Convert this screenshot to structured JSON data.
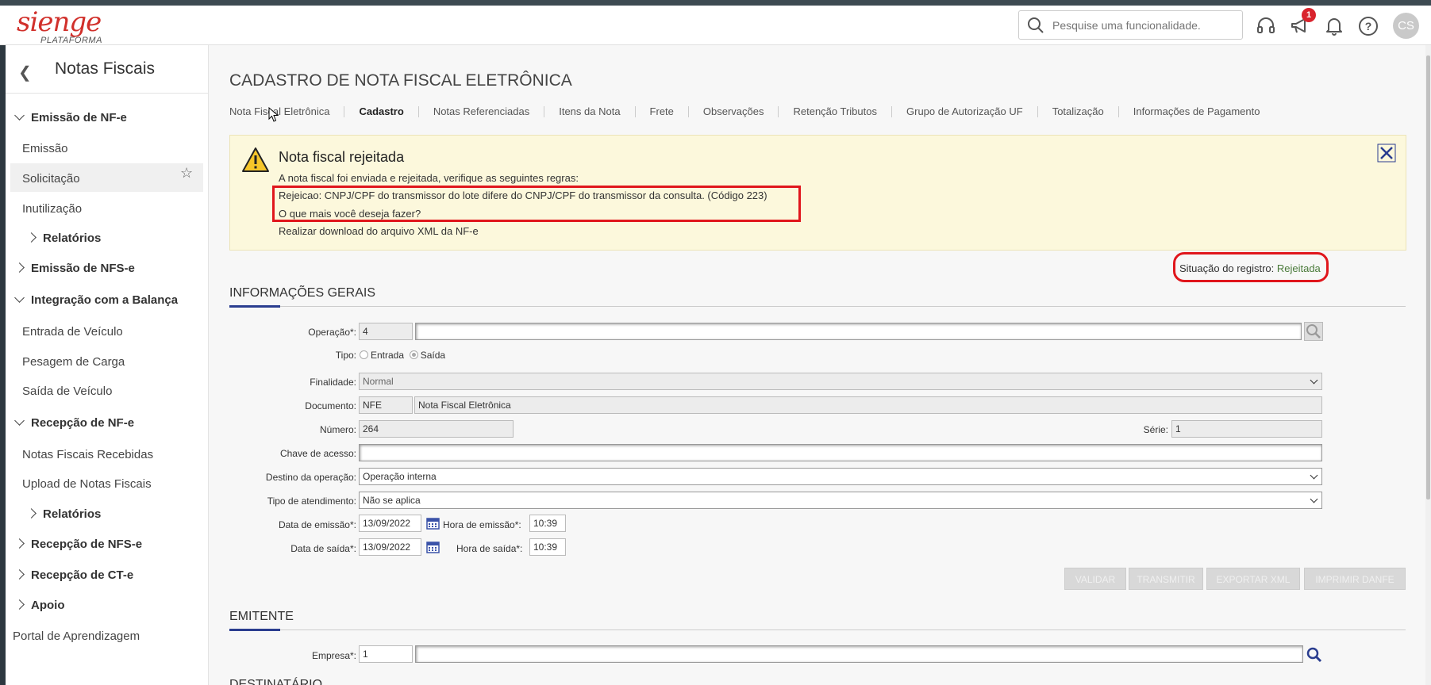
{
  "header": {
    "logo_main": "sienge",
    "logo_sub": "PLATAFORMA",
    "search_placeholder": "Pesquise uma funcionalidade.",
    "notification_count": "1",
    "avatar_initials": "CS"
  },
  "sidebar": {
    "title": "Notas Fiscais",
    "items": [
      {
        "label": "Emissão de NF-e",
        "type": "group-open"
      },
      {
        "label": "Emissão",
        "type": "item"
      },
      {
        "label": "Solicitação",
        "type": "item-selected"
      },
      {
        "label": "Inutilização",
        "type": "item"
      },
      {
        "label": "Relatórios",
        "type": "subgroup-closed"
      },
      {
        "label": "Emissão de NFS-e",
        "type": "group-closed"
      },
      {
        "label": "Integração com a Balança",
        "type": "group-open"
      },
      {
        "label": "Entrada de Veículo",
        "type": "item"
      },
      {
        "label": "Pesagem de Carga",
        "type": "item"
      },
      {
        "label": "Saída de Veículo",
        "type": "item"
      },
      {
        "label": "Recepção de NF-e",
        "type": "group-open"
      },
      {
        "label": "Notas Fiscais Recebidas",
        "type": "item"
      },
      {
        "label": "Upload de Notas Fiscais",
        "type": "item"
      },
      {
        "label": "Relatórios",
        "type": "subgroup-closed"
      },
      {
        "label": "Recepção de NFS-e",
        "type": "group-closed"
      },
      {
        "label": "Recepção de CT-e",
        "type": "group-closed"
      },
      {
        "label": "Apoio",
        "type": "group-closed"
      },
      {
        "label": "Portal de Aprendizagem",
        "type": "link"
      }
    ]
  },
  "main": {
    "page_title": "CADASTRO DE NOTA FISCAL ELETRÔNICA",
    "tabs": [
      "Nota Fiscal Eletrônica",
      "Cadastro",
      "Notas Referenciadas",
      "Itens da Nota",
      "Frete",
      "Observações",
      "Retenção Tributos",
      "Grupo de Autorização UF",
      "Totalização",
      "Informações de Pagamento"
    ],
    "active_tab": "Cadastro",
    "alert": {
      "title": "Nota fiscal rejeitada",
      "intro": "A nota fiscal foi enviada e rejeitada, verifique as seguintes regras:",
      "rule": "Rejeicao: CNPJ/CPF do transmissor do lote difere do CNPJ/CPF do transmissor da consulta. (Código 223)",
      "question": "O que mais você deseja fazer?",
      "download": "Realizar download do arquivo XML da NF-e"
    },
    "status_label": "Situação do registro:",
    "status_value": "Rejeitada",
    "section_general": "INFORMAÇÕES GERAIS",
    "form": {
      "operacao_label": "Operação*:",
      "operacao_code": "4",
      "operacao_desc": "",
      "tipo_label": "Tipo:",
      "tipo_entrada": "Entrada",
      "tipo_saida": "Saída",
      "finalidade_label": "Finalidade:",
      "finalidade_value": "Normal",
      "documento_label": "Documento:",
      "documento_code": "NFE",
      "documento_desc": "Nota Fiscal Eletrônica",
      "numero_label": "Número:",
      "numero_value": "264",
      "serie_label": "Série:",
      "serie_value": "1",
      "chave_label": "Chave de acesso:",
      "chave_value": "",
      "destino_label": "Destino da operação:",
      "destino_value": "Operação interna",
      "atendimento_label": "Tipo de atendimento:",
      "atendimento_value": "Não se aplica",
      "data_emissao_label": "Data de emissão*:",
      "data_emissao_value": "13/09/2022",
      "hora_emissao_label": "Hora de emissão*:",
      "hora_emissao_value": "10:39",
      "data_saida_label": "Data de saída*:",
      "data_saida_value": "13/09/2022",
      "hora_saida_label": "Hora de saída*:",
      "hora_saida_value": "10:39"
    },
    "buttons": {
      "validar": "VALIDAR",
      "transmitir": "TRANSMITIR",
      "exportar": "EXPORTAR XML",
      "imprimir": "IMPRIMIR DANFE"
    },
    "section_emitente": "EMITENTE",
    "empresa_label": "Empresa*:",
    "empresa_code": "1",
    "empresa_desc": "",
    "section_destinatario": "DESTINATÁRIO"
  },
  "colors": {
    "brand_red": "#d1302b",
    "alert_bg": "#fcf8dc",
    "highlight_red": "#e0161c",
    "section_accent": "#2a3d8f",
    "status_green": "#4a7a3a"
  }
}
